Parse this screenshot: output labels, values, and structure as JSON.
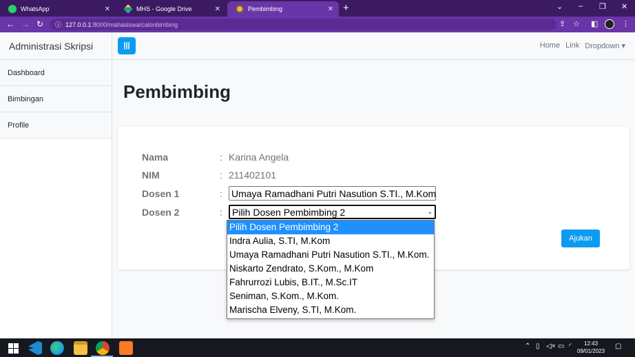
{
  "browser": {
    "tabs": [
      {
        "title": "WhatsApp",
        "active": false
      },
      {
        "title": "MHS - Google Drive",
        "active": false
      },
      {
        "title": "Pembimbing",
        "active": true
      }
    ],
    "url_host": "127.0.0.1",
    "url_rest": ":8000/mahasiswa/calonbimbing",
    "new_tab": "+",
    "window_controls": [
      "⌄",
      "–",
      "❐",
      "✕"
    ]
  },
  "sidebar": {
    "brand": "Administrasi Skripsi",
    "items": [
      {
        "label": "Dashboard"
      },
      {
        "label": "Bimbingan"
      },
      {
        "label": "Profile"
      }
    ]
  },
  "navbar": {
    "toggle_label": "|||",
    "links": [
      "Home",
      "Link",
      "Dropdown"
    ]
  },
  "page": {
    "title": "Pembimbing"
  },
  "form": {
    "colon": ":",
    "nama_label": "Nama",
    "nama_value": "Karina Angela",
    "nim_label": "NIM",
    "nim_value": "211402101",
    "dosen1_label": "Dosen 1",
    "dosen1_selected": "Umaya Ramadhani Putri Nasution S.TI., M.Kom.",
    "dosen2_label": "Dosen 2",
    "dosen2_selected": "Pilih Dosen Pembimbing 2",
    "submit_label": "Ajukan",
    "dosen2_options": [
      "Pilih Dosen Pembimbing 2",
      "Indra Aulia, S.TI, M.Kom",
      "Umaya Ramadhani Putri Nasution S.TI., M.Kom.",
      "Niskarto Zendrato, S.Kom., M.Kom",
      "Fahrurrozi Lubis, B.IT., M.Sc.IT",
      "Seniman, S.Kom., M.Kom.",
      "Marischa Elveny, S.TI, M.Kom."
    ]
  },
  "taskbar": {
    "time": "12:43",
    "date": "09/01/2023"
  },
  "colors": {
    "browser_frame": "#6a35a8",
    "primary_button": "#0d9bf2",
    "selected_option": "#1e90ff"
  }
}
